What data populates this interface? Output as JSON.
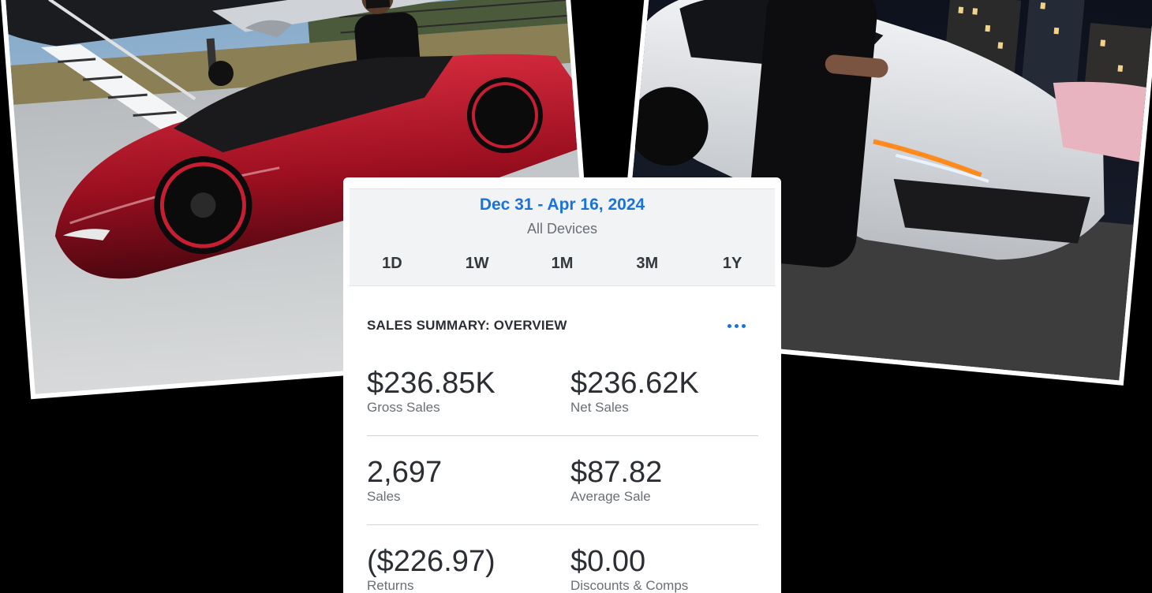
{
  "sales_card": {
    "date_range": "Dec 31 - Apr 16, 2024",
    "device_filter": "All Devices",
    "range_tabs": [
      "1D",
      "1W",
      "1M",
      "3M",
      "1Y"
    ],
    "summary_title": "SALES SUMMARY: OVERVIEW",
    "more_icon": "ellipsis-icon",
    "metrics": [
      {
        "value": "$236.85K",
        "label": "Gross Sales"
      },
      {
        "value": "$236.62K",
        "label": "Net Sales"
      },
      {
        "value": "2,697",
        "label": "Sales"
      },
      {
        "value": "$87.82",
        "label": "Average Sale"
      },
      {
        "value": "($226.97)",
        "label": "Returns"
      },
      {
        "value": "$0.00",
        "label": "Discounts & Comps"
      }
    ],
    "accent_color": "#1a73d9"
  },
  "photos": {
    "left": "red-sports-car-and-private-jet-photo",
    "right": "white-suv-at-night-photo"
  }
}
